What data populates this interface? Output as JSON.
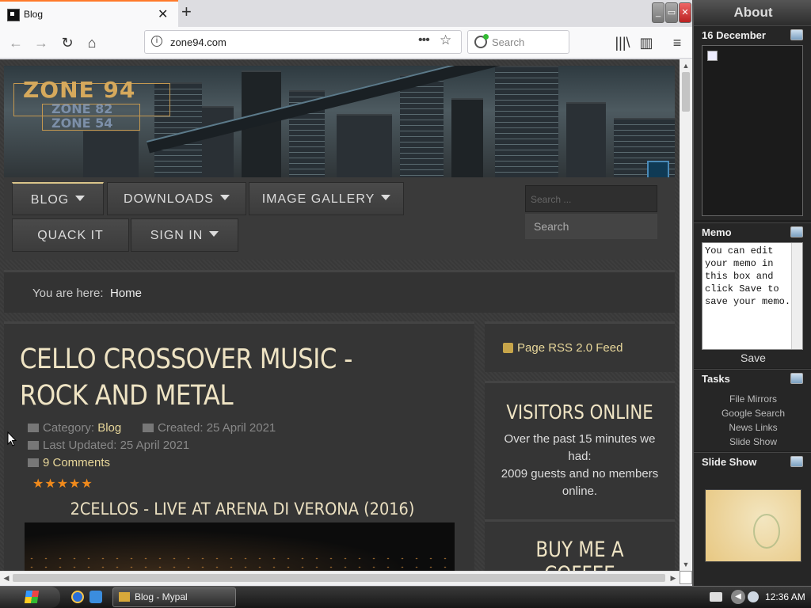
{
  "browser": {
    "tab_title": "Blog",
    "tab_close": "✕",
    "new_tab": "+",
    "url": "zone94.com",
    "url_info": "i",
    "url_more": "•••",
    "url_star": "☆",
    "search_placeholder": "Search",
    "nav": {
      "back": "←",
      "forward": "→",
      "reload": "↻",
      "home": "⌂",
      "library": "|||\\",
      "sidebar": "▥",
      "menu": "≡"
    },
    "window": {
      "min": "_",
      "max": "▭",
      "close": "✕"
    }
  },
  "site": {
    "logo_top": "ZONE 94",
    "logo_mid": "ZONE 82",
    "logo_bot": "ZONE 54",
    "menu": {
      "blog": "BLOG",
      "downloads": "DOWNLOADS",
      "gallery": "IMAGE GALLERY",
      "quack": "QUACK IT",
      "signin": "SIGN IN"
    },
    "search_placeholder": "Search ...",
    "search_button": "Search",
    "breadcrumb_label": "You are here:",
    "breadcrumb_home": "Home"
  },
  "article": {
    "title": "CELLO CROSSOVER MUSIC - ROCK AND METAL",
    "category_label": "Category:",
    "category": "Blog",
    "created": "Created: 25 April 2021",
    "updated": "Last Updated: 25 April 2021",
    "comments": "9 Comments",
    "stars": "★★★★★",
    "rating": 5,
    "video_title": "2CELLOS - LIVE AT ARENA DI VERONA (2016)"
  },
  "side": {
    "rss": "Page RSS 2.0 Feed",
    "visitors_title": "VISITORS ONLINE",
    "visitors_text_1": "Over the past 15 minutes we had:",
    "visitors_text_2": "2009 guests and no members online.",
    "coffee_title": "BUY ME A COFFEE"
  },
  "gadgets": {
    "title": "About",
    "date": "16 December",
    "memo_title": "Memo",
    "memo_text": "You can edit your memo in this box and click Save to save your memo.",
    "memo_save": "Save",
    "tasks_title": "Tasks",
    "tasks": [
      "File Mirrors",
      "Google Search",
      "News Links",
      "Slide Show"
    ],
    "slideshow_title": "Slide Show"
  },
  "taskbar": {
    "task": "Blog - Mypal",
    "clock": "12:36 AM"
  },
  "scroll": {
    "up": "▲",
    "down": "▼",
    "left": "◀",
    "right": "▶"
  }
}
